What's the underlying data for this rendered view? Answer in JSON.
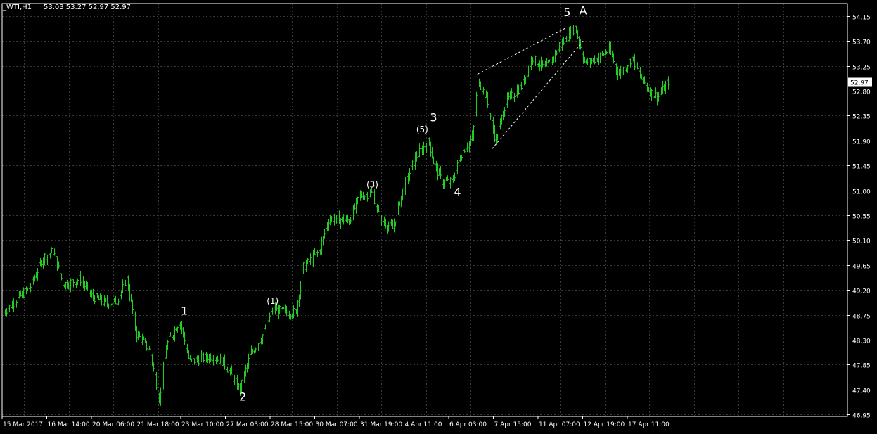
{
  "header": {
    "symbol": "_WTI,H1",
    "ohlc": "53.03 53.27 52.97 52.97"
  },
  "colors": {
    "background": "#000000",
    "grid": "#3a3a3a",
    "bars": "#22cc22",
    "axis": "#ffffff",
    "price_line": "#9a9a9a",
    "labels": "#ffffff",
    "trendline": "#ffffff"
  },
  "chart_data": {
    "type": "ohlc",
    "grid": true,
    "style": "dotted-grid",
    "price_axis": {
      "side": "right",
      "ticks": [
        "54.15",
        "53.70",
        "53.25",
        "52.80",
        "52.35",
        "51.90",
        "51.45",
        "51.00",
        "50.55",
        "50.10",
        "49.65",
        "49.20",
        "48.75",
        "48.30",
        "47.85",
        "47.40",
        "46.95"
      ],
      "ylim": [
        46.95,
        54.15
      ]
    },
    "time_axis": {
      "ticks": [
        "15 Mar 2017",
        "16 Mar 14:00",
        "20 Mar 06:00",
        "21 Mar 18:00",
        "23 Mar 10:00",
        "27 Mar 03:00",
        "28 Mar 15:00",
        "30 Mar 07:00",
        "31 Mar 19:00",
        "4 Apr 11:00",
        "6 Apr 03:00",
        "7 Apr 15:00",
        "11 Apr 07:00",
        "12 Apr 19:00",
        "17 Apr 11:00"
      ]
    },
    "current_price": "52.97",
    "anchors": [
      {
        "t": 0,
        "p": 48.8
      },
      {
        "t": 0.04,
        "p": 49.25
      },
      {
        "t": 0.06,
        "p": 49.8
      },
      {
        "t": 0.075,
        "p": 49.9
      },
      {
        "t": 0.09,
        "p": 49.3
      },
      {
        "t": 0.115,
        "p": 49.4
      },
      {
        "t": 0.13,
        "p": 49.1
      },
      {
        "t": 0.155,
        "p": 48.95
      },
      {
        "t": 0.17,
        "p": 49.0
      },
      {
        "t": 0.185,
        "p": 49.4
      },
      {
        "t": 0.2,
        "p": 48.4
      },
      {
        "t": 0.22,
        "p": 48.1
      },
      {
        "t": 0.235,
        "p": 47.2
      },
      {
        "t": 0.245,
        "p": 48.2
      },
      {
        "t": 0.265,
        "p": 48.65
      },
      {
        "t": 0.28,
        "p": 47.9
      },
      {
        "t": 0.31,
        "p": 48.0
      },
      {
        "t": 0.33,
        "p": 47.9
      },
      {
        "t": 0.355,
        "p": 47.4
      },
      {
        "t": 0.37,
        "p": 48.0
      },
      {
        "t": 0.39,
        "p": 48.4
      },
      {
        "t": 0.405,
        "p": 48.85
      },
      {
        "t": 0.425,
        "p": 48.8
      },
      {
        "t": 0.44,
        "p": 48.8
      },
      {
        "t": 0.45,
        "p": 49.6
      },
      {
        "t": 0.475,
        "p": 49.9
      },
      {
        "t": 0.49,
        "p": 50.5
      },
      {
        "t": 0.52,
        "p": 50.45
      },
      {
        "t": 0.535,
        "p": 50.9
      },
      {
        "t": 0.555,
        "p": 50.95
      },
      {
        "t": 0.565,
        "p": 50.5
      },
      {
        "t": 0.585,
        "p": 50.3
      },
      {
        "t": 0.6,
        "p": 51.0
      },
      {
        "t": 0.62,
        "p": 51.6
      },
      {
        "t": 0.64,
        "p": 51.9
      },
      {
        "t": 0.647,
        "p": 51.5
      },
      {
        "t": 0.66,
        "p": 51.15
      },
      {
        "t": 0.675,
        "p": 51.15
      },
      {
        "t": 0.69,
        "p": 51.7
      },
      {
        "t": 0.705,
        "p": 51.95
      },
      {
        "t": 0.713,
        "p": 53.0
      },
      {
        "t": 0.725,
        "p": 52.7
      },
      {
        "t": 0.74,
        "p": 51.9
      },
      {
        "t": 0.755,
        "p": 52.6
      },
      {
        "t": 0.78,
        "p": 52.9
      },
      {
        "t": 0.795,
        "p": 53.4
      },
      {
        "t": 0.815,
        "p": 53.2
      },
      {
        "t": 0.84,
        "p": 53.65
      },
      {
        "t": 0.86,
        "p": 53.95
      },
      {
        "t": 0.875,
        "p": 53.3
      },
      {
        "t": 0.895,
        "p": 53.4
      },
      {
        "t": 0.91,
        "p": 53.55
      },
      {
        "t": 0.925,
        "p": 53.1
      },
      {
        "t": 0.945,
        "p": 53.4
      },
      {
        "t": 0.96,
        "p": 53.0
      },
      {
        "t": 0.975,
        "p": 52.75
      },
      {
        "t": 0.985,
        "p": 52.7
      },
      {
        "t": 1.0,
        "p": 52.97
      }
    ],
    "wave_labels": [
      {
        "text": "1",
        "t": 0.272,
        "p": 48.75
      },
      {
        "text": "2",
        "t": 0.36,
        "p": 47.2
      },
      {
        "text": "(1)",
        "t": 0.405,
        "p": 48.95
      },
      {
        "text": "(3)",
        "t": 0.555,
        "p": 51.05
      },
      {
        "text": "(5)",
        "t": 0.63,
        "p": 52.05
      },
      {
        "text": "3",
        "t": 0.647,
        "p": 52.25
      },
      {
        "text": "4",
        "t": 0.683,
        "p": 50.9
      },
      {
        "text": "5",
        "t": 0.848,
        "p": 54.15
      },
      {
        "text": "A",
        "t": 0.872,
        "p": 54.18
      }
    ],
    "trendlines": [
      {
        "t1": 0.713,
        "p1": 53.1,
        "t2": 0.848,
        "p2": 53.95
      },
      {
        "t1": 0.735,
        "p1": 51.75,
        "t2": 0.872,
        "p2": 53.7
      }
    ]
  }
}
